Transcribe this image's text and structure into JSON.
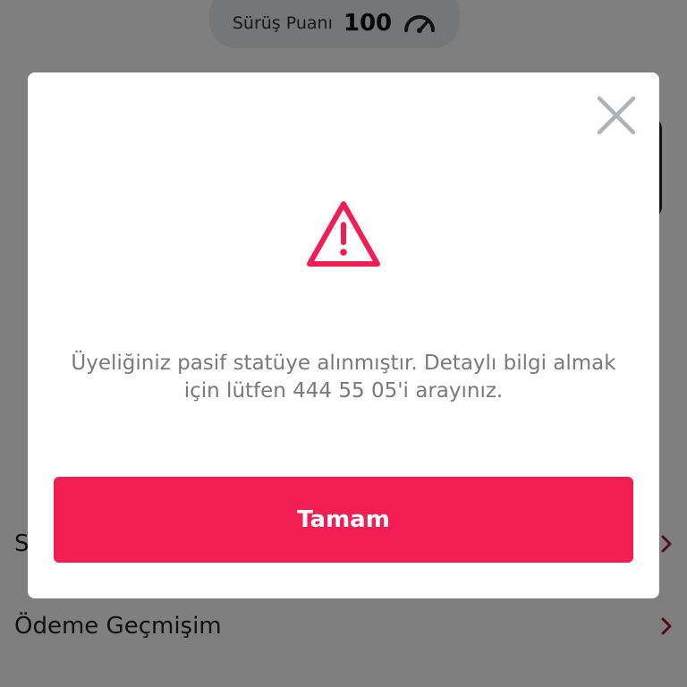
{
  "header": {
    "score_label": "Sürüş Puanı",
    "score_value": "100",
    "score_icon": "speedometer-icon"
  },
  "menu": {
    "items": [
      {
        "label": "S",
        "icon": "chevron-right-icon"
      },
      {
        "label": "Ödeme Geçmişim",
        "icon": "chevron-right-icon"
      }
    ]
  },
  "dialog": {
    "icon": "warning-icon",
    "close_icon": "close-icon",
    "message": "Üyeliğiniz pasif statüye alınmıştır. Detaylı bilgi almak için lütfen 444 55 05'i arayınız.",
    "ok_label": "Tamam"
  },
  "colors": {
    "accent": "#f21d52",
    "chevron": "#a01838",
    "message_text": "#7a7a7a",
    "close_icon": "#aab4bc"
  }
}
